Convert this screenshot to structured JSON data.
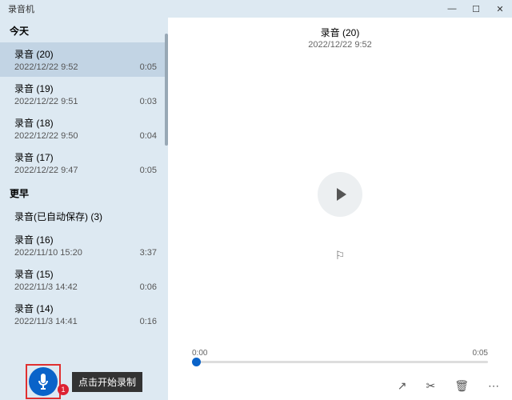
{
  "app_title": "录音机",
  "window_controls": {
    "min": "—",
    "max": "☐",
    "close": "✕"
  },
  "sidebar": {
    "groups": [
      {
        "label": "今天",
        "items": [
          {
            "title": "录音 (20)",
            "date": "2022/12/22 9:52",
            "duration": "0:05",
            "selected": true
          },
          {
            "title": "录音 (19)",
            "date": "2022/12/22 9:51",
            "duration": "0:03"
          },
          {
            "title": "录音 (18)",
            "date": "2022/12/22 9:50",
            "duration": "0:04"
          },
          {
            "title": "录音 (17)",
            "date": "2022/12/22 9:47",
            "duration": "0:05"
          }
        ]
      },
      {
        "label": "更早",
        "items": [
          {
            "title": "录音(已自动保存) (3)",
            "date": "",
            "duration": ""
          },
          {
            "title": "录音 (16)",
            "date": "2022/11/10 15:20",
            "duration": "3:37"
          },
          {
            "title": "录音 (15)",
            "date": "2022/11/3 14:42",
            "duration": "0:06"
          },
          {
            "title": "录音 (14)",
            "date": "2022/11/3 14:41",
            "duration": "0:16"
          }
        ]
      }
    ]
  },
  "record": {
    "badge": "1",
    "tooltip": "点击开始录制"
  },
  "player": {
    "title": "录音 (20)",
    "date": "2022/12/22 9:52",
    "time_start": "0:00",
    "time_end": "0:05"
  }
}
